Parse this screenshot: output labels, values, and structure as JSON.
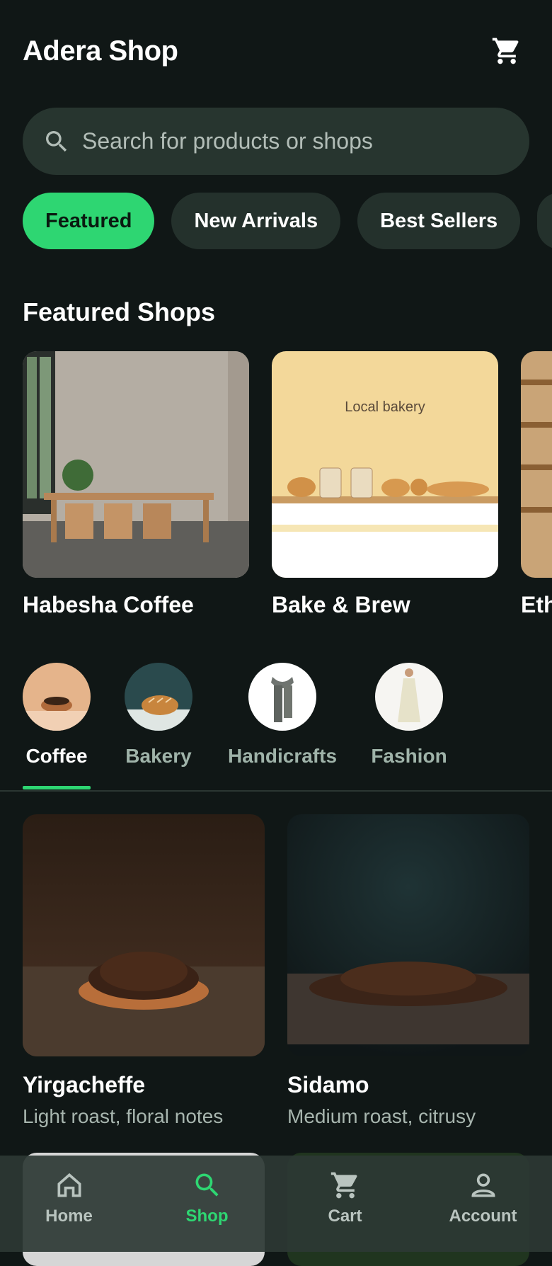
{
  "app": {
    "title": "Adera Shop"
  },
  "search": {
    "placeholder": "Search for products or shops"
  },
  "chips": [
    {
      "label": "Featured",
      "active": true
    },
    {
      "label": "New Arrivals",
      "active": false
    },
    {
      "label": "Best Sellers",
      "active": false
    }
  ],
  "featured": {
    "title": "Featured Shops",
    "shops": [
      {
        "name": "Habesha Coffee"
      },
      {
        "name": "Bake & Brew",
        "image_text": "Local bakery"
      },
      {
        "name": "Eth"
      }
    ]
  },
  "categories": [
    {
      "label": "Coffee",
      "active": true
    },
    {
      "label": "Bakery",
      "active": false
    },
    {
      "label": "Handicrafts",
      "active": false
    },
    {
      "label": "Fashion",
      "active": false
    }
  ],
  "products": [
    {
      "title": "Yirgacheffe",
      "subtitle": "Light roast, floral notes"
    },
    {
      "title": "Sidamo",
      "subtitle": "Medium roast, citrusy"
    }
  ],
  "nav": [
    {
      "label": "Home",
      "icon": "home-icon",
      "active": false
    },
    {
      "label": "Shop",
      "icon": "search-icon",
      "active": true
    },
    {
      "label": "Cart",
      "icon": "cart-icon",
      "active": false
    },
    {
      "label": "Account",
      "icon": "account-icon",
      "active": false
    }
  ],
  "colors": {
    "accent": "#2ed672",
    "background": "#101716",
    "surface": "#24312c"
  }
}
